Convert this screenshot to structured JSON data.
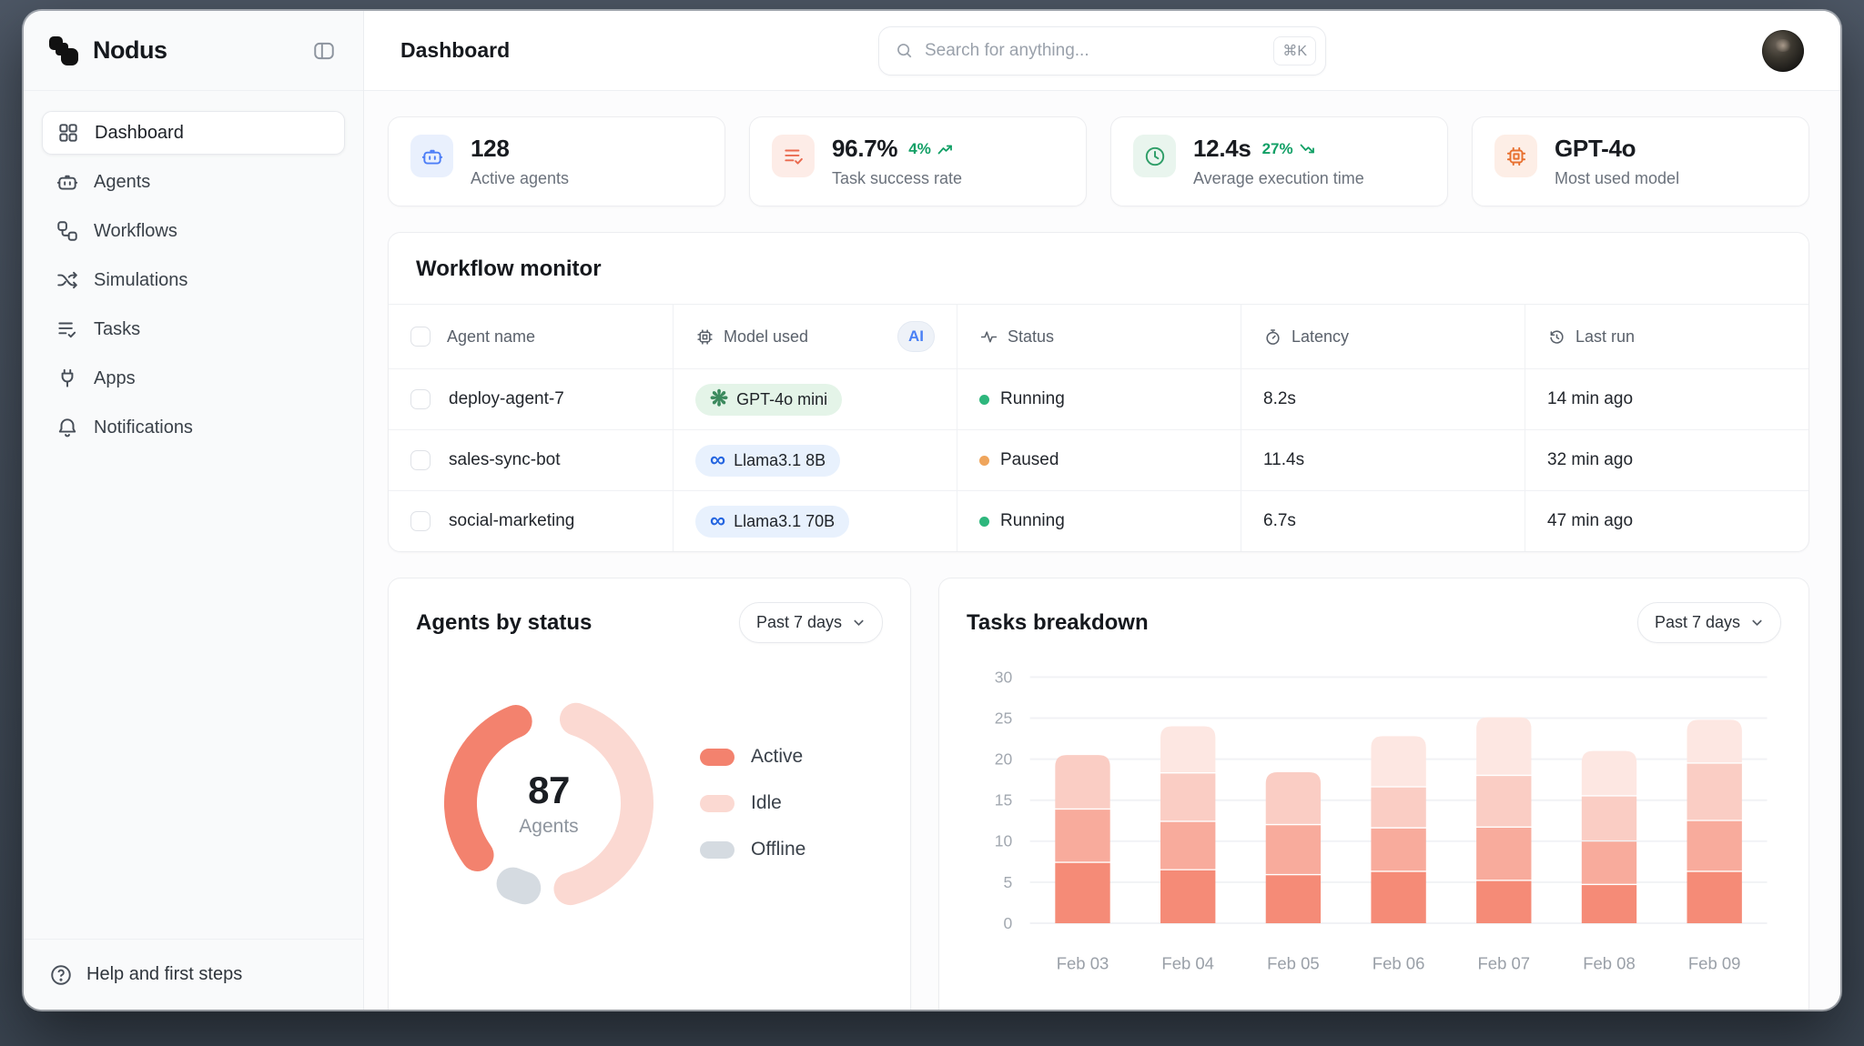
{
  "app": {
    "name": "Nodus"
  },
  "header": {
    "title": "Dashboard",
    "search_placeholder": "Search for anything...",
    "search_shortcut": "⌘K"
  },
  "sidebar": {
    "items": [
      {
        "label": "Dashboard",
        "icon": "grid-icon",
        "active": true
      },
      {
        "label": "Agents",
        "icon": "robot-icon",
        "active": false
      },
      {
        "label": "Workflows",
        "icon": "workflow-icon",
        "active": false
      },
      {
        "label": "Simulations",
        "icon": "shuffle-icon",
        "active": false
      },
      {
        "label": "Tasks",
        "icon": "list-check-icon",
        "active": false
      },
      {
        "label": "Apps",
        "icon": "plug-icon",
        "active": false
      },
      {
        "label": "Notifications",
        "icon": "bell-icon",
        "active": false
      }
    ],
    "help_label": "Help and first steps"
  },
  "stats": [
    {
      "value": "128",
      "label": "Active agents",
      "icon": "robot-icon",
      "tile_bg": "#e9f0fd",
      "tile_fg": "#4d7ef7"
    },
    {
      "value": "96.7%",
      "delta": "4%",
      "trend": "up",
      "label": "Task success rate",
      "icon": "task-lines-icon",
      "tile_bg": "#fdece7",
      "tile_fg": "#ea6a4f"
    },
    {
      "value": "12.4s",
      "delta": "27%",
      "trend": "down",
      "label": "Average execution time",
      "icon": "clock-icon",
      "tile_bg": "#e9f5ee",
      "tile_fg": "#2f9e68"
    },
    {
      "value": "GPT-4o",
      "label": "Most used model",
      "icon": "chip-icon",
      "tile_bg": "#fdeee6",
      "tile_fg": "#e8702f"
    }
  ],
  "workflow": {
    "title": "Workflow monitor",
    "ai_badge": "AI",
    "columns": [
      {
        "label": "Agent name",
        "icon": "checkbox"
      },
      {
        "label": "Model used",
        "icon": "chip-icon"
      },
      {
        "label": "Status",
        "icon": "pulse-icon"
      },
      {
        "label": "Latency",
        "icon": "stopwatch-icon"
      },
      {
        "label": "Last run",
        "icon": "history-icon"
      }
    ],
    "rows": [
      {
        "name": "deploy-agent-7",
        "model": "GPT-4o mini",
        "provider": "openai",
        "pill": "green",
        "status": "Running",
        "status_color": "#2eb77d",
        "latency": "8.2s",
        "last_run": "14 min ago"
      },
      {
        "name": "sales-sync-bot",
        "model": "Llama3.1 8B",
        "provider": "meta",
        "pill": "blue",
        "status": "Paused",
        "status_color": "#efa55c",
        "latency": "11.4s",
        "last_run": "32 min ago"
      },
      {
        "name": "social-marketing",
        "model": "Llama3.1 70B",
        "provider": "meta",
        "pill": "blue",
        "status": "Running",
        "status_color": "#2eb77d",
        "latency": "6.7s",
        "last_run": "47 min ago"
      }
    ]
  },
  "agents_by_status": {
    "title": "Agents by status",
    "range": "Past 7 days",
    "center_value": "87",
    "center_label": "Agents"
  },
  "tasks_breakdown": {
    "title": "Tasks breakdown",
    "range": "Past 7 days"
  },
  "chart_data": [
    {
      "type": "pie",
      "variant": "donut",
      "title": "Agents by status",
      "center_value": 87,
      "center_label": "Agents",
      "legend_position": "right",
      "segments": [
        {
          "label": "Active",
          "value_pct": 41,
          "color": "#f3826e",
          "start_deg": 234,
          "sweep_deg": 104
        },
        {
          "label": "Idle",
          "value_pct": 50,
          "color": "#fbd9d2",
          "start_deg": 18,
          "sweep_deg": 148
        },
        {
          "label": "Offline",
          "value_pct": 9,
          "color": "#d5dbe1",
          "start_deg": 196,
          "sweep_deg": 8
        }
      ]
    },
    {
      "type": "bar",
      "variant": "stacked",
      "title": "Tasks breakdown",
      "categories": [
        "Feb 03",
        "Feb 04",
        "Feb 05",
        "Feb 06",
        "Feb 07",
        "Feb 08",
        "Feb 09"
      ],
      "series": [
        {
          "name": "segment-1-darkest",
          "color": "#f58b77",
          "values": [
            7.5,
            6.6,
            6.0,
            6.4,
            5.3,
            4.8,
            6.4
          ]
        },
        {
          "name": "segment-2-medium",
          "color": "#f8ab9c",
          "values": [
            6.5,
            5.9,
            6.1,
            5.3,
            6.5,
            5.3,
            6.2
          ]
        },
        {
          "name": "segment-3-light",
          "color": "#facdc4",
          "values": [
            6.5,
            5.9,
            6.3,
            5.0,
            6.3,
            5.5,
            7.0
          ]
        },
        {
          "name": "segment-4-lightest",
          "color": "#fde7e2",
          "values": [
            0,
            5.6,
            0,
            6.1,
            7.0,
            5.4,
            5.2
          ]
        }
      ],
      "totals": [
        20.5,
        24.0,
        18.4,
        22.8,
        25.1,
        21.0,
        24.8
      ],
      "xlabel": "",
      "ylabel": "",
      "ylim": [
        0,
        30
      ],
      "ytick_step": 5,
      "grid": true,
      "legend_position": "none"
    }
  ]
}
